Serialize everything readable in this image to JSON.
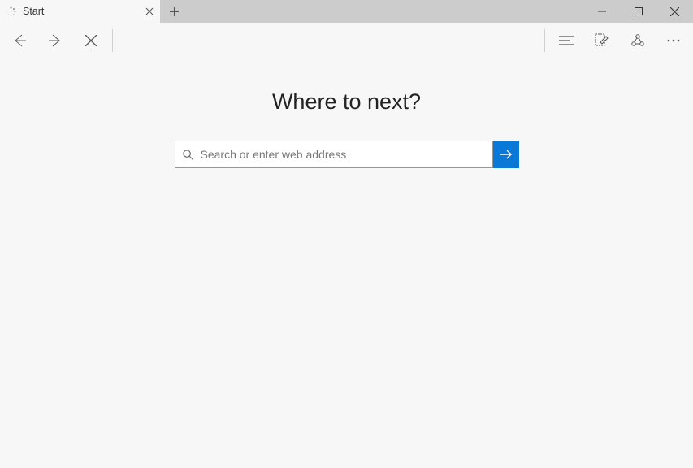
{
  "tab": {
    "title": "Start"
  },
  "main": {
    "heading": "Where to next?",
    "search_placeholder": "Search or enter web address"
  },
  "colors": {
    "accent": "#0a78d6"
  }
}
